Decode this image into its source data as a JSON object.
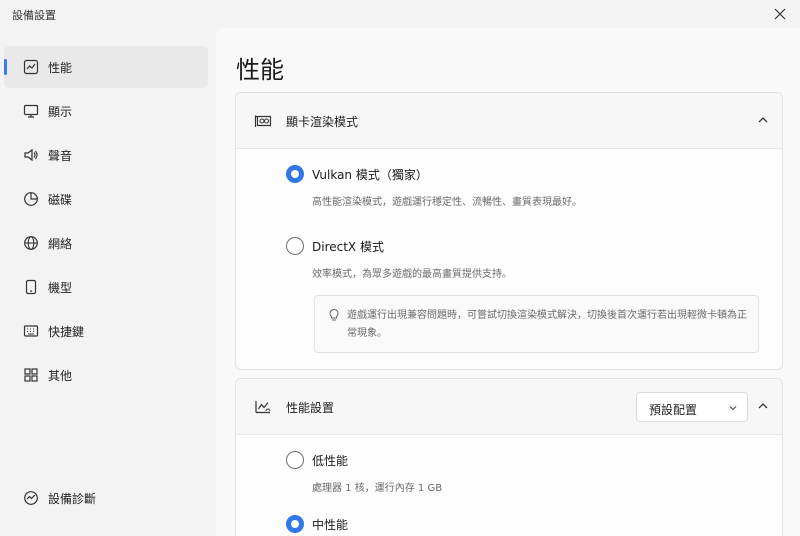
{
  "window": {
    "title": "設備設置"
  },
  "sidebar": {
    "items": [
      {
        "label": "性能",
        "icon": "chart-line-icon",
        "active": true
      },
      {
        "label": "顯示",
        "icon": "monitor-icon"
      },
      {
        "label": "聲音",
        "icon": "speaker-icon"
      },
      {
        "label": "磁碟",
        "icon": "disk-icon"
      },
      {
        "label": "網絡",
        "icon": "globe-icon"
      },
      {
        "label": "機型",
        "icon": "phone-icon"
      },
      {
        "label": "快捷鍵",
        "icon": "keyboard-icon"
      },
      {
        "label": "其他",
        "icon": "grid-icon"
      }
    ],
    "bottom": {
      "label": "設備診斷",
      "icon": "diagnostics-icon"
    }
  },
  "main": {
    "page_title": "性能",
    "renderer_card": {
      "title": "顯卡渲染模式",
      "options": [
        {
          "label": "Vulkan 模式（獨家）",
          "desc": "高性能渲染模式，遊戲運行穩定性、流暢性、畫質表現最好。",
          "selected": true
        },
        {
          "label": "DirectX 模式",
          "desc": "效率模式，為眾多遊戲的最高畫質提供支持。",
          "selected": false
        }
      ],
      "tip": "遊戲運行出現兼容問題時，可嘗試切換渲染模式解決，切換後首次運行若出現輕微卡頓為正常現象。"
    },
    "perf_card": {
      "title": "性能設置",
      "select_value": "預設配置",
      "options": [
        {
          "label": "低性能",
          "desc": "處理器 1 核，運行內存 1 GB",
          "selected": false
        },
        {
          "label": "中性能",
          "selected": true
        }
      ]
    }
  },
  "colors": {
    "accent": "#2f78e6",
    "sidebar_bg": "#f3f3f3",
    "content_bg": "#f9f9f9"
  }
}
